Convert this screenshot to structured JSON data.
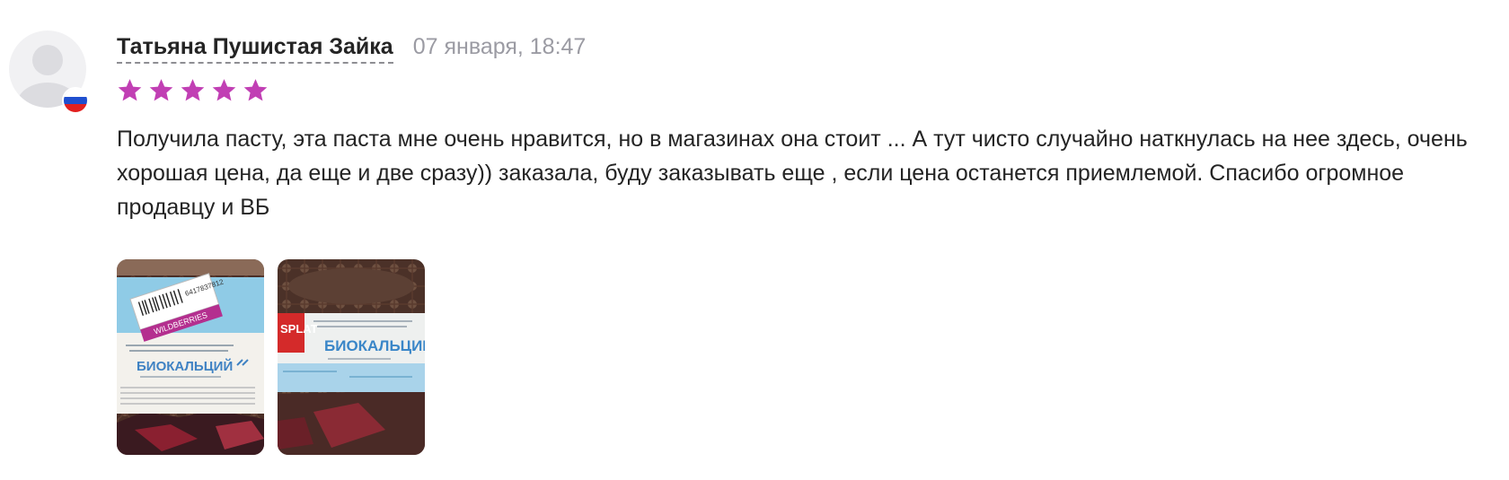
{
  "review": {
    "author": "Татьяна Пушистая Зайка",
    "date": "07 января, 18:47",
    "rating": 5,
    "rating_max": 5,
    "country_flag": "russia-flag-icon",
    "text": "Получила пасту, эта паста мне очень нравится, но в магазинах она стоит ... А тут чисто случайно наткнулась на нее здесь, очень хорошая цена, да еще и две сразу)) заказала, буду заказывать еще , если цена останется приемлемой. Спасибо огромное продавцу и ВБ",
    "photos": [
      {
        "name": "review-photo-1",
        "product_title": "БИОКАЛЬЦИЙ",
        "sticker": "WILDBERRIES",
        "barcode": "6417837812"
      },
      {
        "name": "review-photo-2",
        "product_title": "БИОКАЛЬЦИЙ",
        "brand": "SPLAT"
      }
    ]
  },
  "colors": {
    "star": "#c13fb4",
    "date": "#9b9ba3",
    "text": "#242424"
  }
}
